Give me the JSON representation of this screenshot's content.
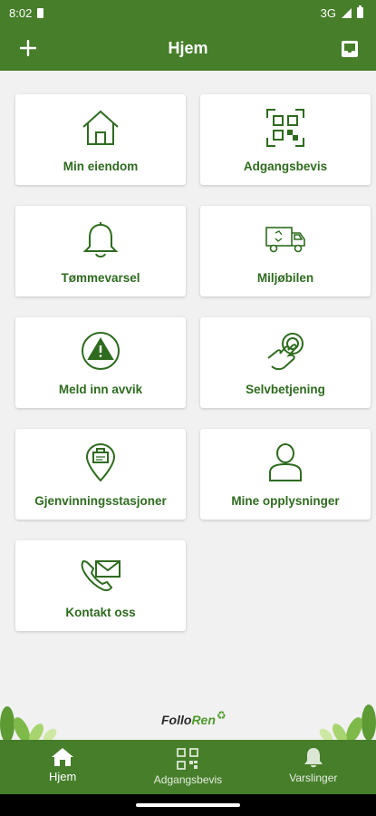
{
  "status_bar": {
    "time": "8:02",
    "network": "3G"
  },
  "app_bar": {
    "title": "Hjem",
    "add_icon": "plus-icon",
    "inbox_icon": "inbox-icon"
  },
  "tiles": [
    {
      "label": "Min eiendom",
      "icon": "house-icon"
    },
    {
      "label": "Adgangsbevis",
      "icon": "qr-code-icon"
    },
    {
      "label": "Tømmevarsel",
      "icon": "bell-icon"
    },
    {
      "label": "Miljøbilen",
      "icon": "truck-icon"
    },
    {
      "label": "Meld inn avvik",
      "icon": "warning-icon"
    },
    {
      "label": "Selvbetjening",
      "icon": "touch-hand-icon"
    },
    {
      "label": "Gjenvinningsstasjoner",
      "icon": "location-pin-icon"
    },
    {
      "label": "Mine opplysninger",
      "icon": "person-icon"
    },
    {
      "label": "Kontakt oss",
      "icon": "phone-mail-icon"
    }
  ],
  "footer_logo": {
    "part1": "Follo",
    "part2": "Ren",
    "mark": "♻"
  },
  "bottom_nav": [
    {
      "label": "Hjem",
      "icon": "home-icon",
      "active": true
    },
    {
      "label": "Adgangsbevis",
      "icon": "qr-code-icon",
      "active": false
    },
    {
      "label": "Varslinger",
      "icon": "bell-icon",
      "active": false
    }
  ],
  "colors": {
    "brand_green": "#467e2a",
    "label_green": "#2e6b1f",
    "background": "#f1f1f1"
  }
}
